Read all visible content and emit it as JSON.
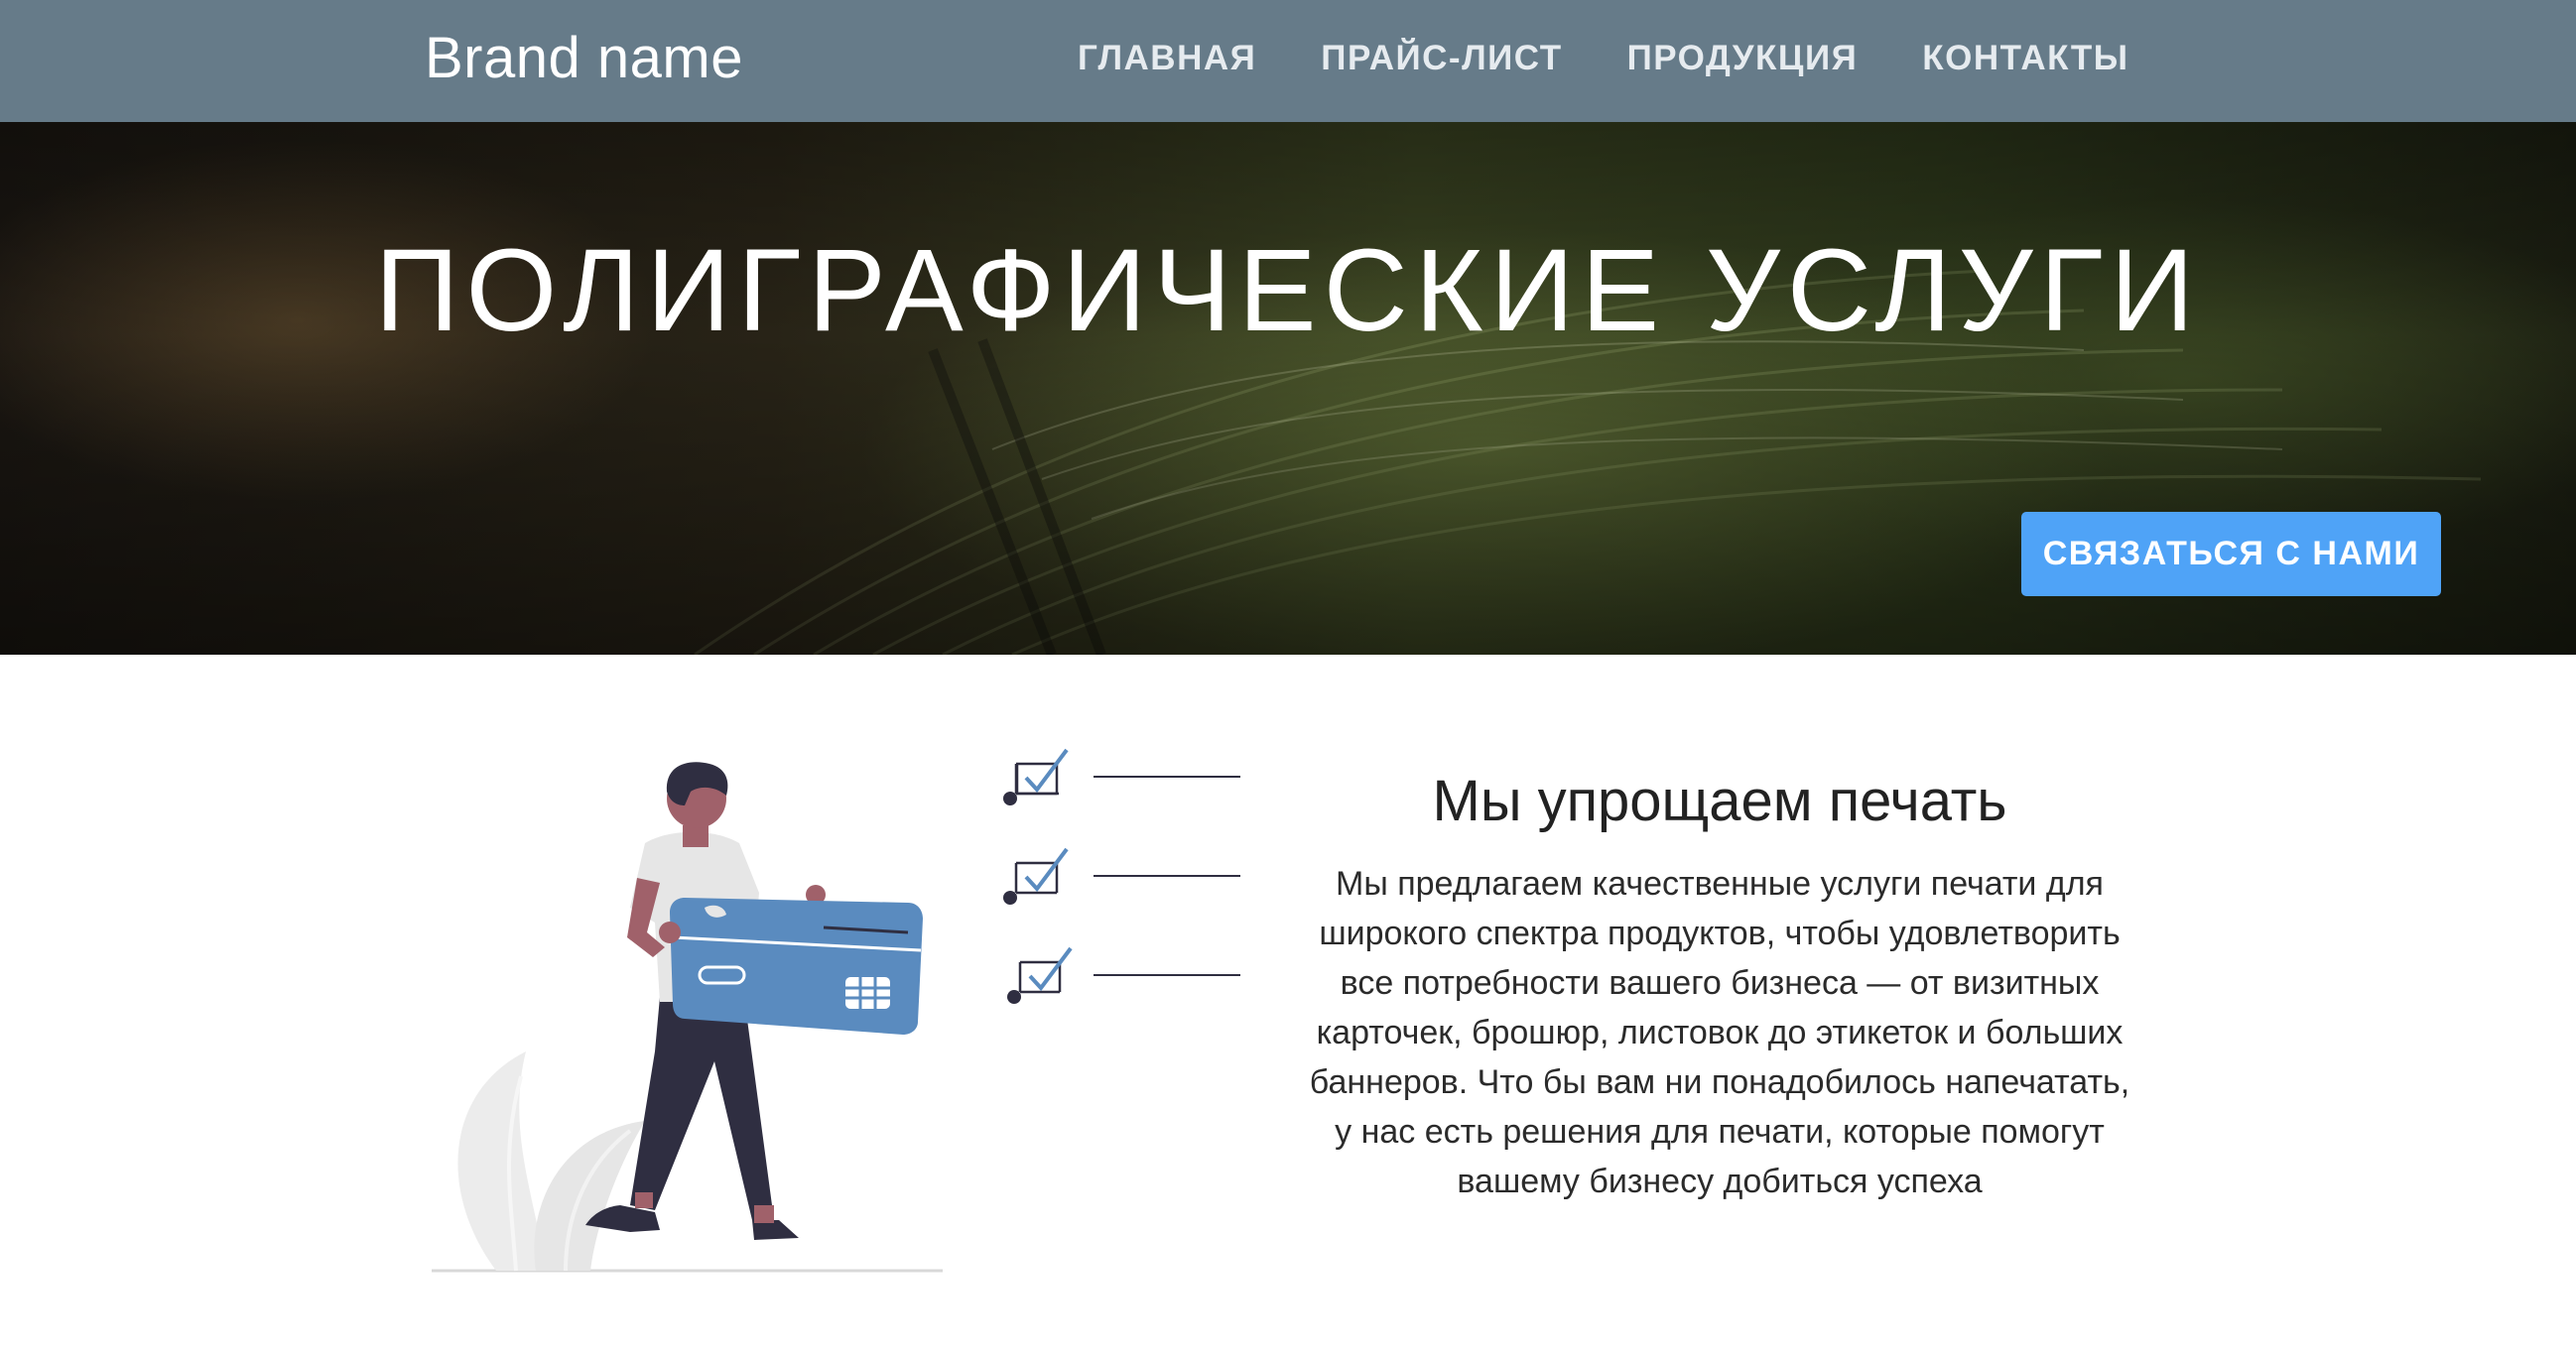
{
  "navbar": {
    "brand": "Brand name",
    "links": [
      {
        "label": "ГЛАВНАЯ"
      },
      {
        "label": "ПРАЙС-ЛИСТ"
      },
      {
        "label": "ПРОДУКЦИЯ"
      },
      {
        "label": "КОНТАКТЫ"
      }
    ],
    "background_color": "#667b89"
  },
  "hero": {
    "title": "ПОЛИГРАФИЧЕСКИЕ УСЛУГИ",
    "cta_label": "СВЯЗАТЬСЯ С НАМИ",
    "cta_color": "#4fa3f7"
  },
  "about": {
    "title": "Мы упрощаем печать",
    "text": "Мы предлагаем качественные услуги печати для широкого спектра продуктов, чтобы удовлетворить все потребности вашего бизнеса — от визитных карточек, брошюр, листовок до этикеток и больших баннеров. Что бы вам ни понадобилось напечатать, у нас есть решения для печати, которые помогут вашему бизнесу добиться успеха"
  },
  "illustration": {
    "accent_color": "#5a8bbf",
    "icons": [
      "person-icon",
      "credit-card-icon",
      "checkbox-icon",
      "plant-icon"
    ]
  }
}
